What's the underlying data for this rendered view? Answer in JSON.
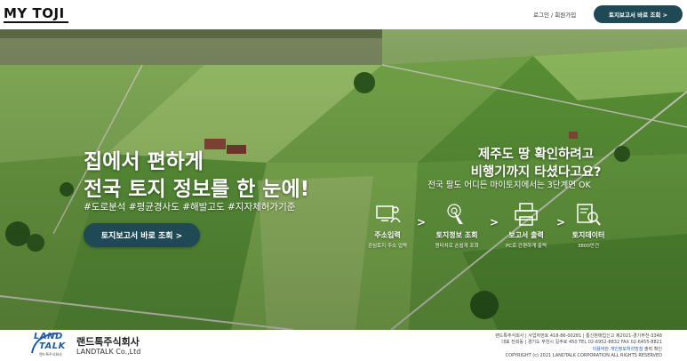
{
  "header": {
    "logo": "MY TOJI",
    "login_link": "로그인 / 회원가입",
    "cta_button": "토지보고서 바로 조회 >"
  },
  "hero": {
    "headline_line1": "집에서 편하게",
    "headline_line2": "전국 토지 정보를 한 눈에!",
    "tags": "#도로분석 #평균경사도 #해발고도 #지자체허가기준",
    "cta_button": "토지보고서 바로 조회 >",
    "promo_line1": "제주도 땅 확인하려고",
    "promo_line2": "비행기까지 타셨다고요?",
    "promo_sub": "전국 팔도 어디든 마이토지에서는 3단계면 OK",
    "steps": [
      {
        "icon": "computer-user-icon",
        "title": "주소입력",
        "subtitle": "관심토지 주소 입력"
      },
      {
        "icon": "click-pointer-icon",
        "title": "토지정보 조회",
        "subtitle": "원터치로 손쉽게 조회"
      },
      {
        "icon": "printer-icon",
        "title": "보고서 출력",
        "subtitle": "PC로 간편하게 출력"
      },
      {
        "icon": "data-search-icon",
        "title": "토지데이터",
        "subtitle": "3800만건"
      }
    ],
    "arrow": ">"
  },
  "footer": {
    "logo_land": "LAND",
    "logo_talk": "TALK",
    "logo_small": "랜드톡주식회사",
    "company_kr": "랜드톡주식회사",
    "company_en": "LANDTALK Co.,Ltd",
    "info_line1": "랜드톡주식회사 | 사업자번호 418-86-00281 | 통신판매업신고 제2021-경기부천-3348",
    "info_line2": "대표 전희동 | 경기도 부천시 길주로 450 TEL 02-6952-8832 FAX 02-6455-8821",
    "terms_link": "이용약관",
    "privacy_link": "개인정보처리방침",
    "print_label": "출력 확인",
    "copyright": "COPYRIGHT (c) 2021 LANDTALK CORPORATION ALL RIGHTS RESERVED"
  },
  "colors": {
    "accent": "#1f4a55",
    "brand_blue": "#1d5aa8",
    "field_green": "#5c9a3a"
  }
}
